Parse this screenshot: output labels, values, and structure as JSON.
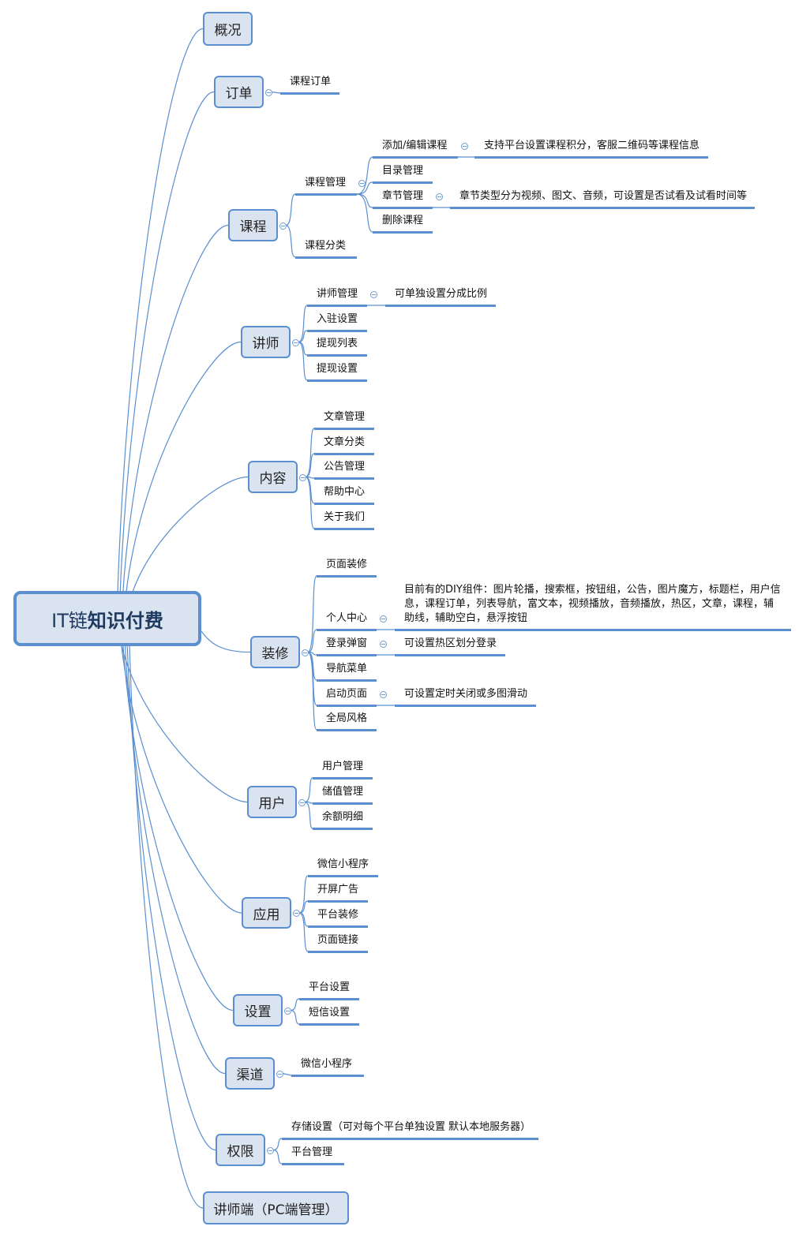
{
  "colors": {
    "line": "#5b8fd0",
    "node_fill": "#dae3f0",
    "root_text": "#1f3a5f"
  },
  "root": {
    "prefix": "IT链",
    "title": "知识付费"
  },
  "branches": [
    {
      "label": "概况",
      "children": []
    },
    {
      "label": "订单",
      "children": [
        {
          "label": "课程订单"
        }
      ]
    },
    {
      "label": "课程",
      "children": [
        {
          "label": "课程管理",
          "children": [
            {
              "label": "添加/编辑课程",
              "note": "支持平台设置课程积分，客服二维码等课程信息"
            },
            {
              "label": "目录管理"
            },
            {
              "label": "章节管理",
              "note": "章节类型分为视频、图文、音频，可设置是否试看及试看时间等"
            },
            {
              "label": "删除课程"
            }
          ]
        },
        {
          "label": "课程分类"
        }
      ]
    },
    {
      "label": "讲师",
      "children": [
        {
          "label": "讲师管理",
          "note": "可单独设置分成比例"
        },
        {
          "label": "入驻设置"
        },
        {
          "label": "提现列表"
        },
        {
          "label": "提现设置"
        }
      ]
    },
    {
      "label": "内容",
      "children": [
        {
          "label": "文章管理"
        },
        {
          "label": "文章分类"
        },
        {
          "label": "公告管理"
        },
        {
          "label": "帮助中心"
        },
        {
          "label": "关于我们"
        }
      ]
    },
    {
      "label": "装修",
      "children": [
        {
          "label": "页面装修"
        },
        {
          "label": "个人中心",
          "note": "目前有的DIY组件：图片轮播，搜索框，按钮组，公告，图片魔方，标题栏，用户信息，课程订单，列表导航，富文本，视频播放，音频播放，热区，文章，课程，辅助线，辅助空白，悬浮按钮"
        },
        {
          "label": "登录弹窗",
          "note": "可设置热区划分登录"
        },
        {
          "label": "导航菜单"
        },
        {
          "label": "启动页面",
          "note": "可设置定时关闭或多图滑动"
        },
        {
          "label": "全局风格"
        }
      ]
    },
    {
      "label": "用户",
      "children": [
        {
          "label": "用户管理"
        },
        {
          "label": "储值管理"
        },
        {
          "label": "余额明细"
        }
      ]
    },
    {
      "label": "应用",
      "children": [
        {
          "label": "微信小程序"
        },
        {
          "label": "开屏广告"
        },
        {
          "label": "平台装修"
        },
        {
          "label": "页面链接"
        }
      ]
    },
    {
      "label": "设置",
      "children": [
        {
          "label": "平台设置"
        },
        {
          "label": "短信设置"
        }
      ]
    },
    {
      "label": "渠道",
      "children": [
        {
          "label": "微信小程序"
        }
      ]
    },
    {
      "label": "权限",
      "children": [
        {
          "label": "存储设置（可对每个平台单独设置 默认本地服务器）"
        },
        {
          "label": "平台管理"
        }
      ]
    },
    {
      "label": "讲师端（PC端管理）",
      "children": []
    }
  ]
}
